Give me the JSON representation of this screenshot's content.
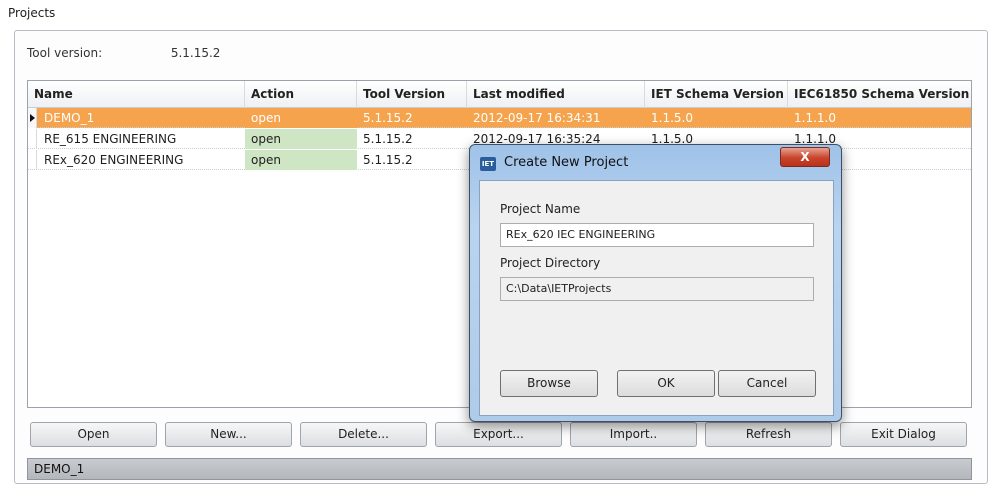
{
  "window": {
    "title": "Projects"
  },
  "tool_version": {
    "label": "Tool version:",
    "value": "5.1.15.2"
  },
  "grid": {
    "columns": [
      "Name",
      "Action",
      "Tool Version",
      "Last modified",
      "IET Schema Version",
      "IEC61850 Schema Version"
    ],
    "rows": [
      {
        "name": "DEMO_1",
        "action": "open",
        "tool_version": "5.1.15.2",
        "last_modified": "2012-09-17 16:34:31",
        "iet_schema": "1.1.5.0",
        "iec_schema": "1.1.1.0"
      },
      {
        "name": "RE_615 ENGINEERING",
        "action": "open",
        "tool_version": "5.1.15.2",
        "last_modified": "2012-09-17 16:35:24",
        "iet_schema": "1.1.5.0",
        "iec_schema": "1.1.1.0"
      },
      {
        "name": "REx_620 ENGINEERING",
        "action": "open",
        "tool_version": "5.1.15.2",
        "last_modified": "",
        "iet_schema": "",
        "iec_schema": ""
      }
    ]
  },
  "buttons": {
    "open": "Open",
    "new": "New...",
    "delete": "Delete...",
    "export": "Export...",
    "import": "Import..",
    "refresh": "Refresh",
    "exit": "Exit Dialog"
  },
  "status": {
    "text": "DEMO_1"
  },
  "dialog": {
    "title": "Create New Project",
    "icon_text": "IET",
    "close": "X",
    "project_name_label": "Project Name",
    "project_name_value": "REx_620 IEC ENGINEERING",
    "project_dir_label": "Project Directory",
    "project_dir_value": "C:\\Data\\IETProjects",
    "browse": "Browse",
    "ok": "OK",
    "cancel": "Cancel"
  },
  "colors": {
    "selected_row": "#f5a44d",
    "action_cell": "#cfe6c4"
  }
}
